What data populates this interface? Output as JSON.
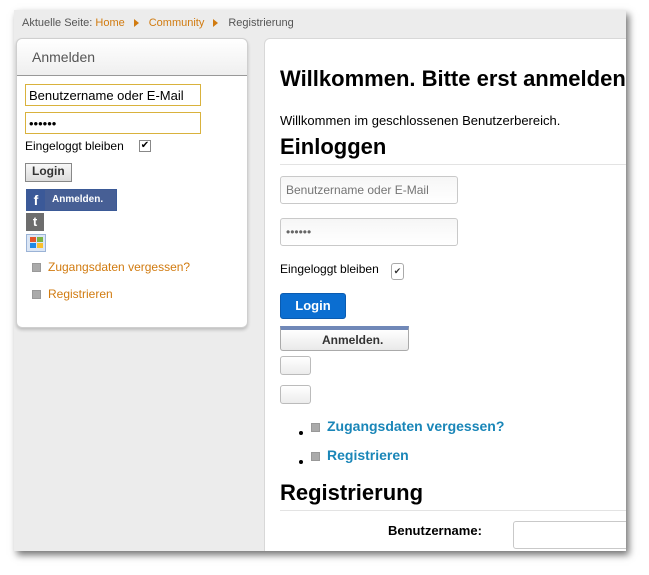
{
  "breadcrumb": {
    "prefix": "Aktuelle Seite:",
    "items": [
      "Home",
      "Community",
      "Registrierung"
    ]
  },
  "sidebar": {
    "title": "Anmelden",
    "username_value": "Benutzername oder E-Mail",
    "password_value": "••••••",
    "remember_label": "Eingeloggt bleiben",
    "remember_checked": "✔",
    "login_label": "Login",
    "facebook_icon": "f",
    "facebook_label": "Anmelden.",
    "twitter_icon": "t",
    "links": [
      "Zugangsdaten vergessen?",
      "Registrieren"
    ]
  },
  "main": {
    "welcome_title": "Willkommen. Bitte erst anmelden.",
    "intro_text": "Willkommen im geschlossenen Benutzerbereich.",
    "login_heading": "Einloggen",
    "username_placeholder": "Benutzername oder E-Mail",
    "password_value": "••••••",
    "remember_label": "Eingeloggt bleiben",
    "remember_checked": "✔",
    "login_label": "Login",
    "anmelden_label": "Anmelden.",
    "links": [
      "Zugangsdaten vergessen?",
      "Registrieren"
    ],
    "register_heading": "Registrierung",
    "username_field_label": "Benutzername:"
  },
  "colors": {
    "accent_orange": "#d17b10",
    "link_blue": "#1a86b8",
    "button_blue": "#0b6ed1",
    "facebook_blue": "#3b5998"
  }
}
